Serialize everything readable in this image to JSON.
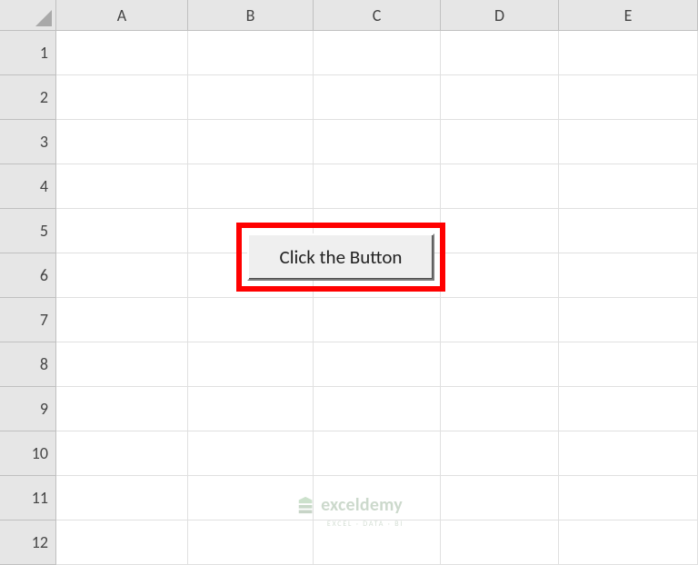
{
  "columns": [
    {
      "label": "A",
      "width": 145
    },
    {
      "label": "B",
      "width": 138
    },
    {
      "label": "C",
      "width": 140
    },
    {
      "label": "D",
      "width": 130
    },
    {
      "label": "E",
      "width": 153
    }
  ],
  "rows": [
    {
      "label": "1"
    },
    {
      "label": "2"
    },
    {
      "label": "3"
    },
    {
      "label": "4"
    },
    {
      "label": "5"
    },
    {
      "label": "6"
    },
    {
      "label": "7"
    },
    {
      "label": "8"
    },
    {
      "label": "9"
    },
    {
      "label": "10"
    },
    {
      "label": "11"
    },
    {
      "label": "12"
    }
  ],
  "button": {
    "label": "Click the Button"
  },
  "watermark": {
    "main": "exceldemy",
    "sub": "EXCEL · DATA · BI"
  },
  "highlight": {
    "color": "#ff0000"
  }
}
